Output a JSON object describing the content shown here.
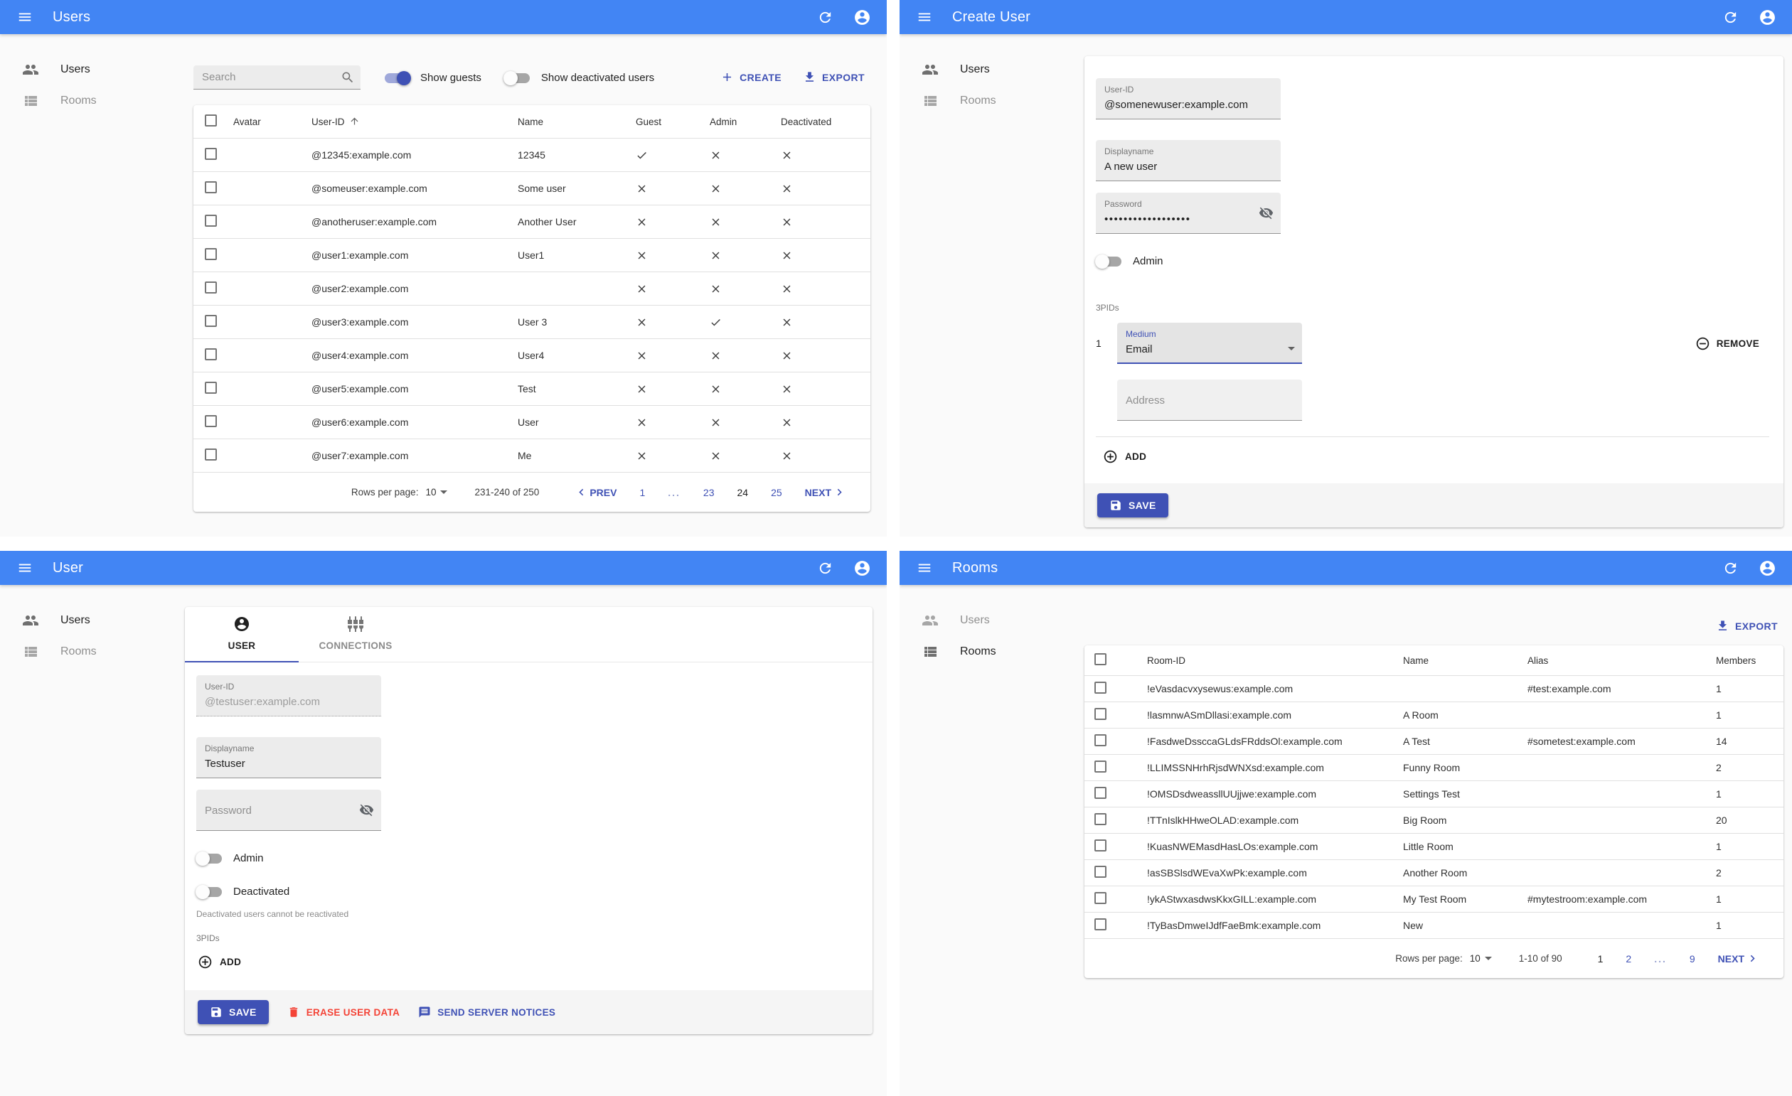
{
  "colors": {
    "appbar_blue": "#4285f4",
    "primary_indigo": "#3f51b5",
    "danger_red": "#f44336",
    "panel_bg": "#fafafa"
  },
  "users_list": {
    "title": "Users",
    "sidebar": {
      "users": "Users",
      "rooms": "Rooms"
    },
    "search_placeholder": "Search",
    "filters": {
      "show_guests": "Show guests",
      "show_guests_on": true,
      "show_deactivated": "Show deactivated users",
      "show_deactivated_on": false
    },
    "actions": {
      "create": "CREATE",
      "export": "EXPORT"
    },
    "columns": {
      "avatar": "Avatar",
      "user_id": "User-ID",
      "name": "Name",
      "guest": "Guest",
      "admin": "Admin",
      "deactivated": "Deactivated"
    },
    "rows": [
      {
        "user_id": "@12345:example.com",
        "name": "12345",
        "guest": true,
        "admin": false,
        "deactivated": false
      },
      {
        "user_id": "@someuser:example.com",
        "name": "Some user",
        "guest": false,
        "admin": false,
        "deactivated": false
      },
      {
        "user_id": "@anotheruser:example.com",
        "name": "Another User",
        "guest": false,
        "admin": false,
        "deactivated": false
      },
      {
        "user_id": "@user1:example.com",
        "name": "User1",
        "guest": false,
        "admin": false,
        "deactivated": false
      },
      {
        "user_id": "@user2:example.com",
        "name": "",
        "guest": false,
        "admin": false,
        "deactivated": false
      },
      {
        "user_id": "@user3:example.com",
        "name": "User 3",
        "guest": false,
        "admin": true,
        "deactivated": false
      },
      {
        "user_id": "@user4:example.com",
        "name": "User4",
        "guest": false,
        "admin": false,
        "deactivated": false
      },
      {
        "user_id": "@user5:example.com",
        "name": "Test",
        "guest": false,
        "admin": false,
        "deactivated": false
      },
      {
        "user_id": "@user6:example.com",
        "name": "User",
        "guest": false,
        "admin": false,
        "deactivated": false
      },
      {
        "user_id": "@user7:example.com",
        "name": "Me",
        "guest": false,
        "admin": false,
        "deactivated": false
      }
    ],
    "footer": {
      "rows_per_page_label": "Rows per page:",
      "rows_per_page": "10",
      "range": "231-240 of 250"
    },
    "pagination": [
      {
        "label": "PREV",
        "type": "prev"
      },
      {
        "label": "1",
        "type": "page"
      },
      {
        "label": "...",
        "type": "ellipsis"
      },
      {
        "label": "23",
        "type": "page"
      },
      {
        "label": "24",
        "type": "current"
      },
      {
        "label": "25",
        "type": "page"
      },
      {
        "label": "NEXT",
        "type": "next"
      }
    ]
  },
  "create_user": {
    "title": "Create User",
    "sidebar": {
      "users": "Users",
      "rooms": "Rooms"
    },
    "fields": {
      "user_id": {
        "label": "User-ID",
        "value": "@somenewuser:example.com"
      },
      "displayname": {
        "label": "Displayname",
        "value": "A new user"
      },
      "password": {
        "label": "Password",
        "value": "••••••••••••••••••"
      },
      "admin_label": "Admin",
      "threepids_label": "3PIDs",
      "row_index": "1",
      "medium": {
        "label": "Medium",
        "value": "Email"
      },
      "remove_label": "REMOVE",
      "address_placeholder": "Address",
      "add_label": "ADD",
      "save_label": "SAVE"
    }
  },
  "user_edit": {
    "title": "User",
    "sidebar": {
      "users": "Users",
      "rooms": "Rooms"
    },
    "tabs": {
      "user": "USER",
      "connections": "CONNECTIONS"
    },
    "fields": {
      "user_id": {
        "label": "User-ID",
        "value": "@testuser:example.com"
      },
      "displayname": {
        "label": "Displayname",
        "value": "Testuser"
      },
      "password_placeholder": "Password",
      "admin_label": "Admin",
      "deactivated_label": "Deactivated",
      "deactivated_helper": "Deactivated users cannot be reactivated",
      "threepids_label": "3PIDs",
      "add_label": "ADD"
    },
    "actions": {
      "save": "SAVE",
      "erase": "ERASE USER DATA",
      "notices": "SEND SERVER NOTICES"
    }
  },
  "rooms_list": {
    "title": "Rooms",
    "sidebar": {
      "users": "Users",
      "rooms": "Rooms"
    },
    "export_label": "EXPORT",
    "columns": {
      "room_id": "Room-ID",
      "name": "Name",
      "alias": "Alias",
      "members": "Members"
    },
    "rows": [
      {
        "room_id": "!eVasdacvxysewus:example.com",
        "name": "",
        "alias": "#test:example.com",
        "members": "1"
      },
      {
        "room_id": "!lasmnwASmDllasi:example.com",
        "name": "A Room",
        "alias": "",
        "members": "1"
      },
      {
        "room_id": "!FasdweDssccaGLdsFRddsOl:example.com",
        "name": "A Test",
        "alias": "#sometest:example.com",
        "members": "14"
      },
      {
        "room_id": "!LLIMSSNHrhRjsdWNXsd:example.com",
        "name": "Funny Room",
        "alias": "",
        "members": "2"
      },
      {
        "room_id": "!OMSDsdweassllUUjjwe:example.com",
        "name": "Settings Test",
        "alias": "",
        "members": "1"
      },
      {
        "room_id": "!TTnIslkHHweOLAD:example.com",
        "name": "Big Room",
        "alias": "",
        "members": "20"
      },
      {
        "room_id": "!KuasNWEMasdHasLOs:example.com",
        "name": "Little Room",
        "alias": "",
        "members": "1"
      },
      {
        "room_id": "!asSBSlsdWEvaXwPk:example.com",
        "name": "Another Room",
        "alias": "",
        "members": "2"
      },
      {
        "room_id": "!ykAStwxasdwsKkxGILL:example.com",
        "name": "My Test Room",
        "alias": "#mytestroom:example.com",
        "members": "1"
      },
      {
        "room_id": "!TyBasDmweIJdfFaeBmk:example.com",
        "name": "New",
        "alias": "",
        "members": "1"
      }
    ],
    "footer": {
      "rows_per_page_label": "Rows per page:",
      "rows_per_page": "10",
      "range": "1-10 of 90"
    },
    "pagination": [
      {
        "label": "1",
        "type": "current"
      },
      {
        "label": "2",
        "type": "page"
      },
      {
        "label": "...",
        "type": "ellipsis"
      },
      {
        "label": "9",
        "type": "page"
      },
      {
        "label": "NEXT",
        "type": "next"
      }
    ]
  }
}
